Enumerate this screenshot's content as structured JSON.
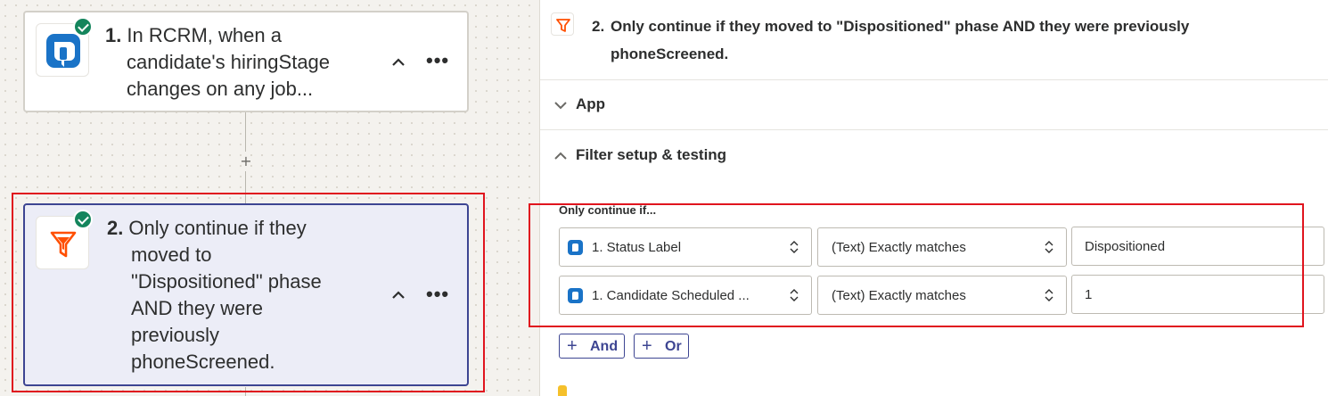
{
  "canvas": {
    "steps": [
      {
        "number": "1.",
        "lines": [
          "In RCRM, when a",
          "candidate's hiringStage",
          "changes on any job..."
        ],
        "app_icon": "rcrm-logo-icon",
        "status": "complete"
      },
      {
        "number": "2.",
        "lines": [
          "Only continue if they",
          "moved to",
          "\"Dispositioned\" phase",
          "AND they were",
          "previously",
          "phoneScreened."
        ],
        "app_icon": "filter-icon",
        "status": "complete"
      }
    ],
    "add_step_symbol": "+"
  },
  "panel": {
    "title_number": "2.",
    "title_lines": [
      "Only continue if they moved to \"Dispositioned\" phase AND they were previously",
      "phoneScreened."
    ],
    "sections": [
      {
        "label": "App",
        "expanded": false
      },
      {
        "label": "Filter setup & testing",
        "expanded": true
      }
    ],
    "filter": {
      "caption": "Only continue if...",
      "conditions": [
        {
          "field": "1. Status Label",
          "operator": "(Text) Exactly matches",
          "value": "Dispositioned"
        },
        {
          "field": "1. Candidate Scheduled ...",
          "operator": "(Text) Exactly matches",
          "value": "1"
        }
      ],
      "and_label": "And",
      "or_label": "Or"
    }
  },
  "colors": {
    "brand_blue": "#1a73c7",
    "filter_orange": "#ff4f00",
    "check_green": "#14855c",
    "selected_border": "#3d4592",
    "highlight_red": "#e0141e"
  }
}
